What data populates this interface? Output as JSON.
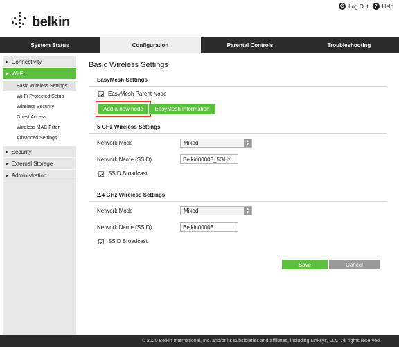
{
  "header": {
    "brand": "belkin",
    "logout_label": "Log Out",
    "help_label": "Help"
  },
  "nav": {
    "tabs": [
      {
        "label": "System Status"
      },
      {
        "label": "Configuration"
      },
      {
        "label": "Parental Controls"
      },
      {
        "label": "Troubleshooting"
      }
    ],
    "active": "Configuration"
  },
  "sidebar": {
    "items": [
      {
        "label": "Connectivity"
      },
      {
        "label": "Wi-Fi"
      },
      {
        "label": "Security"
      },
      {
        "label": "External Storage"
      },
      {
        "label": "Administration"
      }
    ],
    "wifi_sub": [
      {
        "label": "Basic Wireless Settings"
      },
      {
        "label": "Wi-Fi Protected Setup"
      },
      {
        "label": "Wireless Security"
      },
      {
        "label": "Guest Access"
      },
      {
        "label": "Wireless MAC Filter"
      },
      {
        "label": "Advanced Settings"
      }
    ]
  },
  "main": {
    "title": "Basic Wireless Settings",
    "easymesh": {
      "title": "EasyMesh Settings",
      "parent_node_label": "EasyMesh Parent Node",
      "add_node_label": "Add a new node",
      "info_label": "EasyMesh information"
    },
    "ghz5": {
      "title": "5 GHz Wireless Settings",
      "mode_label": "Network Mode",
      "mode_value": "Mixed",
      "ssid_label": "Network Name (SSID)",
      "ssid_value": "Belkin00003_5GHz",
      "broadcast_label": "SSID Broadcast"
    },
    "ghz24": {
      "title": "2.4 GHz Wireless Settings",
      "mode_label": "Network Mode",
      "mode_value": "Mixed",
      "ssid_label": "Network Name (SSID)",
      "ssid_value": "Belkin00003",
      "broadcast_label": "SSID Broadcast"
    },
    "save_label": "Save",
    "cancel_label": "Cancel"
  },
  "footer": {
    "text": "© 2020 Belkin International, Inc. and/or its subsidiaries and affiliates, including Linksys, LLC. All rights reserved."
  },
  "colors": {
    "accent_green": "#5cbf3e",
    "nav_dark": "#2b2b2b",
    "highlight_red": "#e0402a"
  }
}
